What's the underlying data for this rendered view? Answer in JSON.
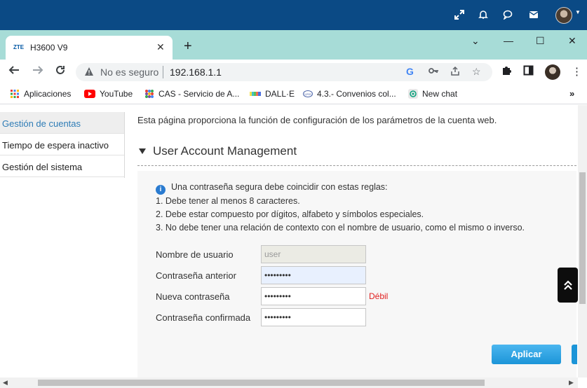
{
  "remote_toolbar": {
    "icons": [
      "expand-icon",
      "bell-icon",
      "chat-icon",
      "mail-icon",
      "user-avatar"
    ]
  },
  "tab": {
    "favicon": "ZTE",
    "title": "H3600 V9",
    "close": "✕",
    "new_tab": "+"
  },
  "window_controls": {
    "minimize": "—",
    "maximize": "☐",
    "close": "✕",
    "menu": "⌄"
  },
  "address_bar": {
    "insecure_label": "No es seguro",
    "url": "192.168.1.1"
  },
  "bookmarks": [
    {
      "label": "Aplicaciones",
      "icon": "apps-grid-icon",
      "color": "#e94235"
    },
    {
      "label": "YouTube",
      "icon": "youtube-icon",
      "color": "#ff0000"
    },
    {
      "label": "CAS - Servicio de A...",
      "icon": "cas-icon",
      "color": "#7a4fa3"
    },
    {
      "label": "DALL·E",
      "icon": "dalle-icon",
      "color": "#f4b400"
    },
    {
      "label": "4.3.- Convenios col...",
      "icon": "uah-icon",
      "color": "#4a63a8"
    },
    {
      "label": "New chat",
      "icon": "openai-icon",
      "color": "#10a37f"
    }
  ],
  "sidebar": {
    "items": [
      {
        "label": "Gestión de cuentas",
        "active": true
      },
      {
        "label": "Tiempo de espera inactivo",
        "active": false
      },
      {
        "label": "Gestión del sistema",
        "active": false
      }
    ]
  },
  "main": {
    "intro": "Esta página proporciona la función de configuración de los parámetros de la cuenta web.",
    "section_title": "User Account Management",
    "rules": {
      "heading": "Una contraseña segura debe coincidir con estas reglas:",
      "items": [
        "1. Debe tener al menos 8 caracteres.",
        "2. Debe estar compuesto por dígitos, alfabeto y símbolos especiales.",
        "3. No debe tener una relación de contexto con el nombre de usuario, como el mismo o inverso."
      ]
    },
    "form": {
      "username_label": "Nombre de usuario",
      "username_value": "user",
      "old_password_label": "Contraseña anterior",
      "old_password_value": "•••••••••",
      "new_password_label": "Nueva contraseña",
      "new_password_value": "•••••••••",
      "strength": "Débil",
      "confirm_password_label": "Contraseña confirmada",
      "confirm_password_value": "•••••••••"
    },
    "apply_label": "Aplicar"
  },
  "colors": {
    "remote_bar": "#0b4a85",
    "tab_strip": "#a7dcd7",
    "active_sidebar_text": "#2e7cb6",
    "apply_button": "#1c95d8",
    "strength_weak": "#e02020"
  }
}
